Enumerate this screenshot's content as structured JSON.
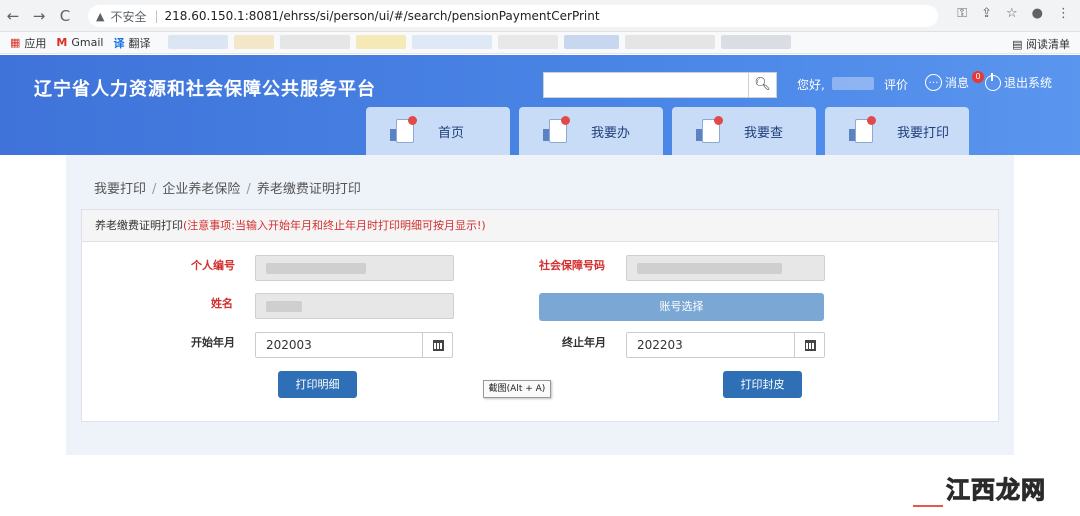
{
  "browser": {
    "back_icon": "←",
    "forward_icon": "→",
    "reload_icon": "C",
    "security_label": "不安全",
    "url": "218.60.150.1:8081/ehrss/si/person/ui/#/search/pensionPaymentCerPrint",
    "bookmarks": [
      {
        "icon": "apps-icon",
        "label": "应用"
      },
      {
        "icon": "gmail-icon",
        "label": "Gmail"
      },
      {
        "icon": "translate-icon",
        "label": "翻译"
      }
    ],
    "reading_list_label": "阅读清单"
  },
  "header": {
    "site_title": "辽宁省人力资源和社会保障公共服务平台",
    "search_placeholder": "",
    "greeting": "您好,",
    "rating_label": "评价",
    "message_label": "消息",
    "message_count": "0",
    "logout_label": "退出系统"
  },
  "tabs": [
    {
      "label": "首页"
    },
    {
      "label": "我要办"
    },
    {
      "label": "我要查"
    },
    {
      "label": "我要打印"
    }
  ],
  "breadcrumb": [
    "我要打印",
    "企业养老保险",
    "养老缴费证明打印"
  ],
  "panel": {
    "title": "养老缴费证明打印",
    "note": "(注意事项:当输入开始年月和终止年月时打印明细可按月显示!)"
  },
  "form": {
    "personal_id_label": "个人编号",
    "ss_number_label": "社会保障号码",
    "name_label": "姓名",
    "account_select_label": "账号选择",
    "start_month_label": "开始年月",
    "start_month_value": "202003",
    "end_month_label": "终止年月",
    "end_month_value": "202203"
  },
  "actions": {
    "print_detail_label": "打印明细",
    "print_cover_label": "打印封皮"
  },
  "tooltip": "截图(Alt + A)",
  "watermark": "江西龙网",
  "colors": {
    "header_blue": "#4a86e6",
    "tab_bg": "#c9dcf7",
    "button_blue": "#2f6fb5",
    "account_button": "#7aa7d4",
    "required_red": "#d32f2f"
  }
}
